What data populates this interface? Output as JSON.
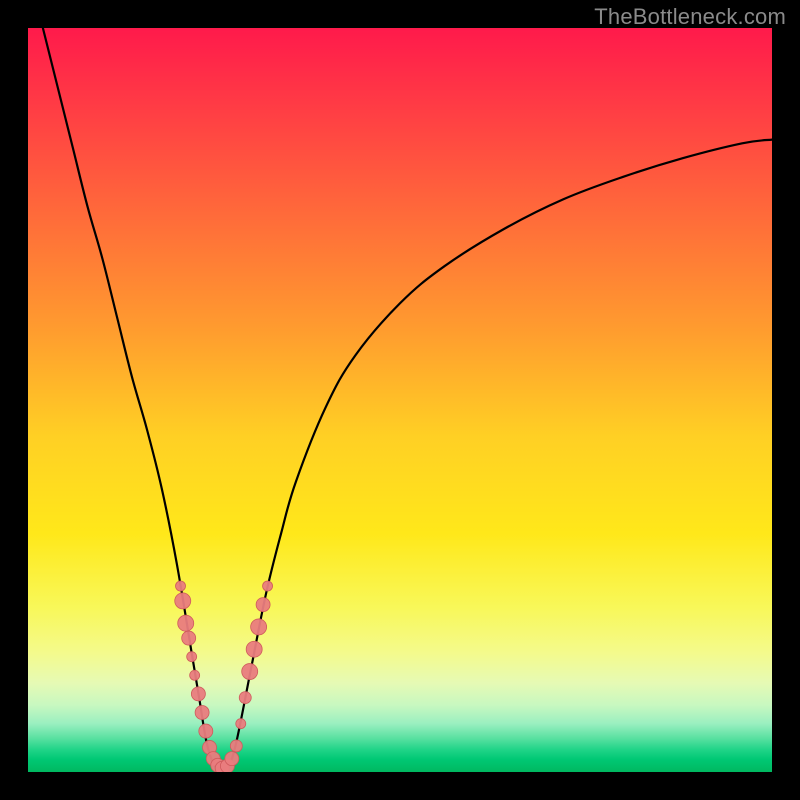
{
  "watermark": "TheBottleneck.com",
  "colors": {
    "frame": "#000000",
    "curve": "#000000",
    "marker_fill": "#e97c7e",
    "marker_stroke": "#cf5a5c",
    "gradient_top": "#ff1a4b",
    "gradient_bottom": "#00b860"
  },
  "chart_data": {
    "type": "line",
    "title": "",
    "xlabel": "",
    "ylabel": "",
    "xlim": [
      0,
      100
    ],
    "ylim": [
      0,
      100
    ],
    "grid": false,
    "legend": false,
    "annotations": [],
    "series": [
      {
        "name": "bottleneck-curve",
        "x": [
          2,
          4,
          6,
          8,
          10,
          12,
          14,
          16,
          18,
          20,
          22,
          23,
          24,
          25,
          26,
          27,
          28,
          30,
          32,
          34,
          36,
          40,
          44,
          50,
          56,
          64,
          72,
          80,
          88,
          96,
          100
        ],
        "y": [
          100,
          92,
          84,
          76,
          69,
          61,
          53,
          46,
          38,
          28,
          16,
          10,
          4,
          1,
          0.5,
          1,
          4,
          14,
          24,
          32,
          39,
          49,
          56,
          63,
          68,
          73,
          77,
          80,
          82.5,
          84.5,
          85
        ]
      }
    ],
    "markers": [
      {
        "x": 20.5,
        "y": 25,
        "r": 5
      },
      {
        "x": 20.8,
        "y": 23,
        "r": 8
      },
      {
        "x": 21.2,
        "y": 20,
        "r": 8
      },
      {
        "x": 21.6,
        "y": 18,
        "r": 7
      },
      {
        "x": 22.0,
        "y": 15.5,
        "r": 5
      },
      {
        "x": 22.4,
        "y": 13,
        "r": 5
      },
      {
        "x": 22.9,
        "y": 10.5,
        "r": 7
      },
      {
        "x": 23.4,
        "y": 8,
        "r": 7
      },
      {
        "x": 23.9,
        "y": 5.5,
        "r": 7
      },
      {
        "x": 24.4,
        "y": 3.3,
        "r": 7
      },
      {
        "x": 24.9,
        "y": 1.8,
        "r": 7
      },
      {
        "x": 25.5,
        "y": 0.9,
        "r": 7
      },
      {
        "x": 26.1,
        "y": 0.5,
        "r": 7
      },
      {
        "x": 26.8,
        "y": 0.8,
        "r": 7
      },
      {
        "x": 27.4,
        "y": 1.8,
        "r": 7
      },
      {
        "x": 28.0,
        "y": 3.5,
        "r": 6
      },
      {
        "x": 28.6,
        "y": 6.5,
        "r": 5
      },
      {
        "x": 29.2,
        "y": 10,
        "r": 6
      },
      {
        "x": 29.8,
        "y": 13.5,
        "r": 8
      },
      {
        "x": 30.4,
        "y": 16.5,
        "r": 8
      },
      {
        "x": 31.0,
        "y": 19.5,
        "r": 8
      },
      {
        "x": 31.6,
        "y": 22.5,
        "r": 7
      },
      {
        "x": 32.2,
        "y": 25,
        "r": 5
      }
    ]
  }
}
